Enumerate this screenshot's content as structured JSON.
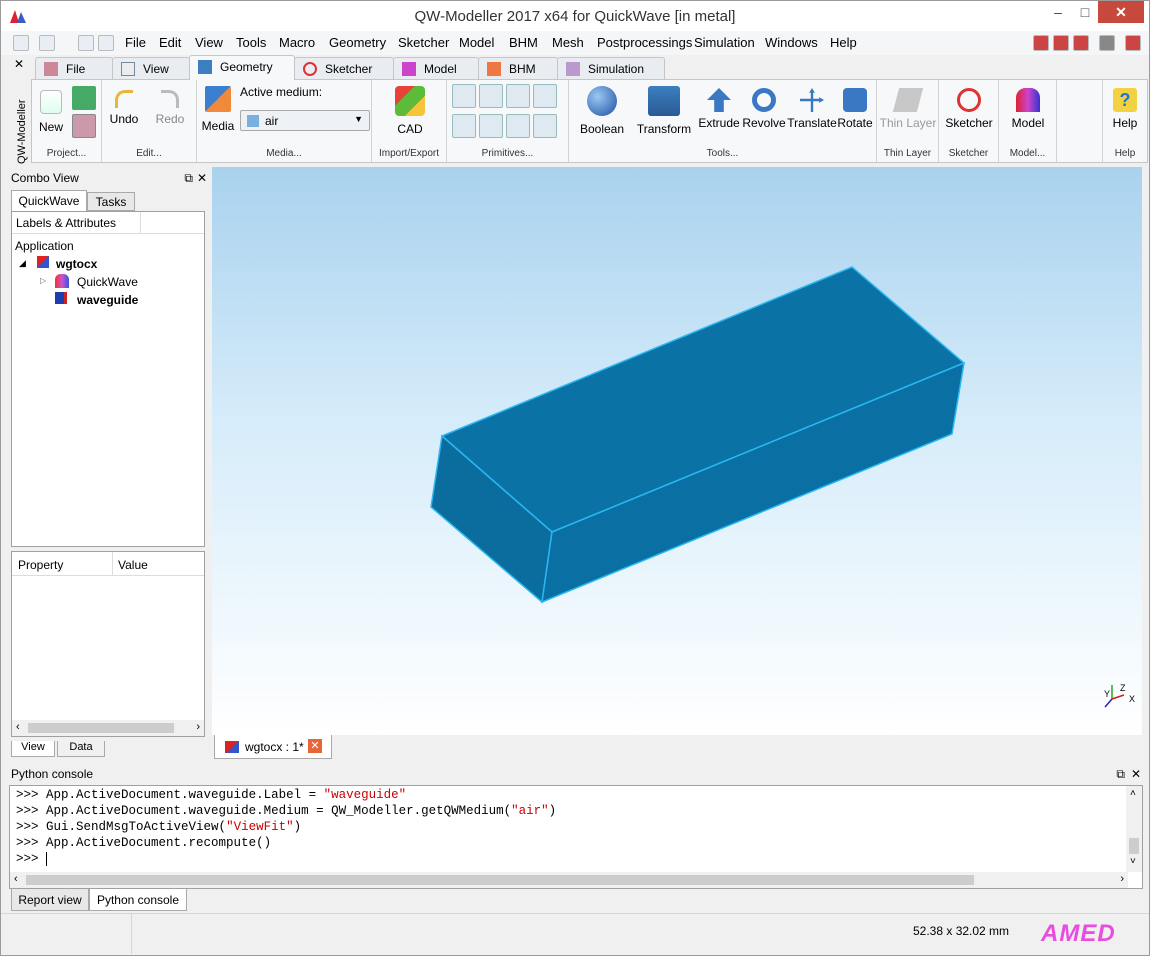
{
  "window": {
    "title": "QW-Modeller 2017 x64 for QuickWave [in metal]",
    "minimize": "‒",
    "maximize": "□",
    "close": "✕"
  },
  "menubar": {
    "items": [
      "File",
      "Edit",
      "View",
      "Tools",
      "Macro",
      "Geometry",
      "Sketcher",
      "Model",
      "BHM",
      "Mesh",
      "Postprocessings",
      "Simulation",
      "Windows",
      "Help"
    ]
  },
  "ribbon": {
    "side_label": "QW-Modeller",
    "tabs": [
      "File",
      "View",
      "Geometry",
      "Sketcher",
      "Model",
      "BHM",
      "Simulation"
    ],
    "active_tab": "Geometry",
    "groups": {
      "project": {
        "label": "Project...",
        "new": "New"
      },
      "edit": {
        "label": "Edit...",
        "undo": "Undo",
        "redo": "Redo"
      },
      "media": {
        "label": "Media...",
        "media_btn": "Media",
        "active_medium_label": "Active medium:",
        "active_medium_value": "air"
      },
      "import": {
        "label": "Import/Export",
        "cad": "CAD"
      },
      "primitives": {
        "label": "Primitives..."
      },
      "tools": {
        "label": "Tools...",
        "boolean": "Boolean",
        "transform": "Transform",
        "extrude": "Extrude",
        "revolve": "Revolve",
        "translate": "Translate",
        "rotate": "Rotate"
      },
      "thin": {
        "label": "Thin Layer",
        "btn": "Thin Layer"
      },
      "sketcher": {
        "label": "Sketcher",
        "btn": "Sketcher"
      },
      "model": {
        "label": "Model...",
        "btn": "Model"
      },
      "help": {
        "label": "Help",
        "btn": "Help"
      }
    }
  },
  "combo_view": {
    "title": "Combo View",
    "tabs": [
      "QuickWave",
      "Tasks"
    ],
    "tree_header": "Labels & Attributes",
    "tree": {
      "root": "Application",
      "doc": "wgtocx",
      "children": [
        "QuickWave",
        "waveguide"
      ]
    },
    "prop_headers": [
      "Property",
      "Value"
    ],
    "bottom_tabs": [
      "View",
      "Data"
    ]
  },
  "document_tab": {
    "label": "wgtocx : 1*"
  },
  "axis": {
    "z": "Z",
    "y": "Y",
    "x": "X"
  },
  "python_console": {
    "title": "Python console",
    "prompt": ">>>",
    "lines": [
      {
        "pre": "App.ActiveDocument.waveguide.Label = ",
        "str": "\"waveguide\"",
        "post": ""
      },
      {
        "pre": "App.ActiveDocument.waveguide.Medium = QW_Modeller.getQWMedium(",
        "str": "\"air\"",
        "post": ")"
      },
      {
        "pre": "Gui.SendMsgToActiveView(",
        "str": "\"ViewFit\"",
        "post": ")"
      },
      {
        "pre": "App.ActiveDocument.recompute()",
        "str": "",
        "post": ""
      }
    ]
  },
  "bottom_tabs": [
    "Report view",
    "Python console"
  ],
  "status": {
    "dimensions": "52.38 x 32.02 mm",
    "logo": "AMED"
  },
  "colors": {
    "box_face": "#0a73a8",
    "box_edge": "#2ab6f0",
    "view_top": "#a9d2ee",
    "logo": "#e94ddf"
  }
}
